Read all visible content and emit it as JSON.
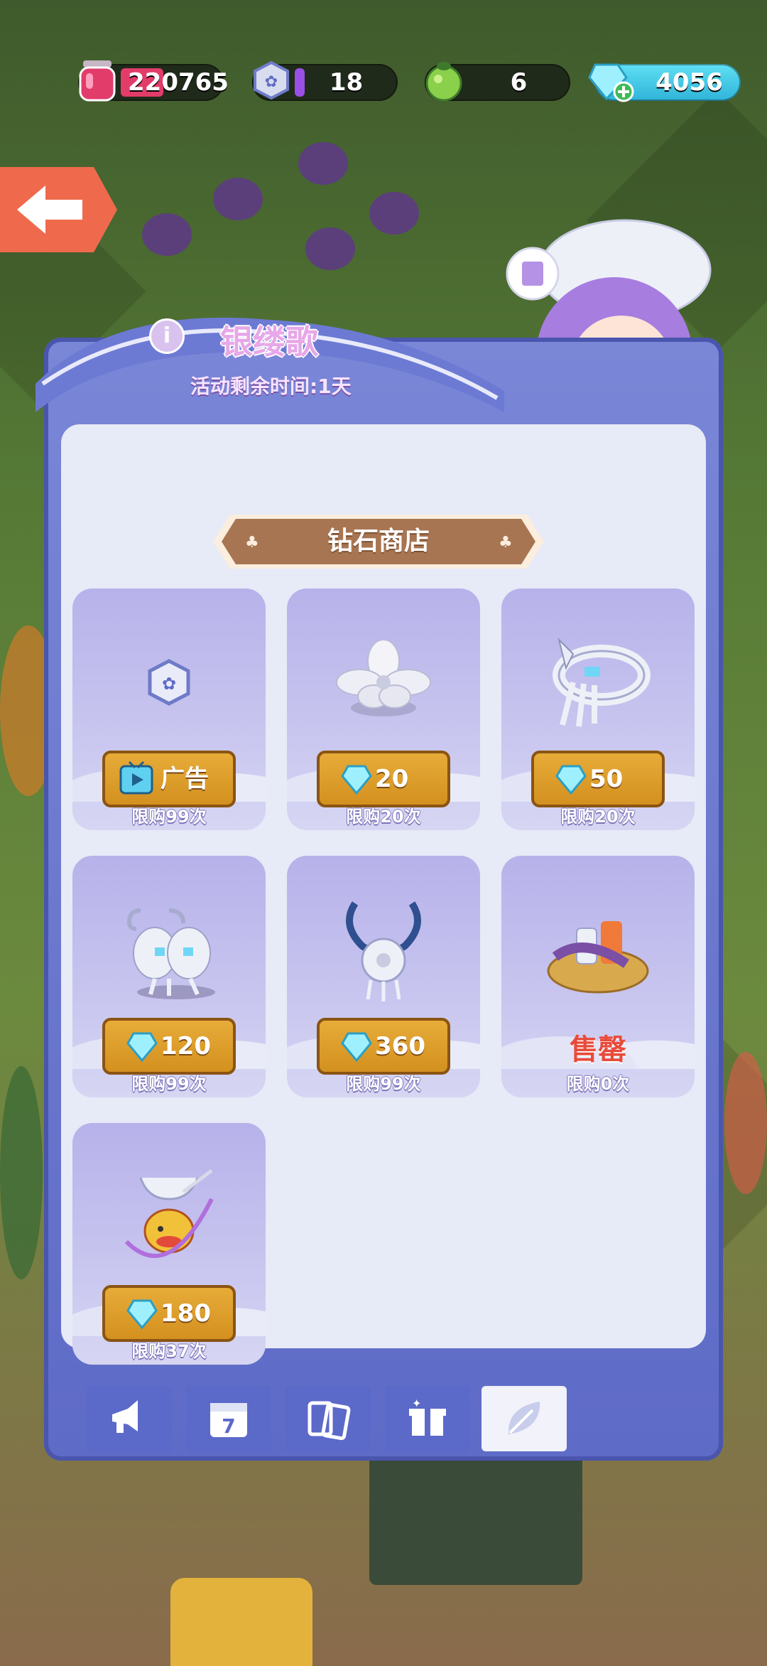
{
  "currencies": [
    {
      "name": "jam",
      "value": "220765",
      "icon": "jam-jar-icon",
      "color": "#e23c6a"
    },
    {
      "name": "badge",
      "value": "18",
      "icon": "silver-badge-icon",
      "color": "#9a4fe6"
    },
    {
      "name": "fruit",
      "value": "6",
      "icon": "green-fruit-icon",
      "color": "#8ad04a"
    },
    {
      "name": "diamond",
      "value": "4056",
      "icon": "diamond-plus-icon",
      "color": "#4fd7f0"
    }
  ],
  "event": {
    "title": "银缕歌",
    "remaining": "活动剩余时间:1天"
  },
  "shop": {
    "title": "钻石商店",
    "items": [
      {
        "name": "silver-badge",
        "button": "广告",
        "kind": "ad",
        "limit": "限购99次"
      },
      {
        "name": "silver-flower",
        "button": "20",
        "kind": "diamond",
        "limit": "限购20次"
      },
      {
        "name": "silver-bracelet",
        "button": "50",
        "kind": "diamond",
        "limit": "限购20次"
      },
      {
        "name": "butterfly-ornament",
        "button": "120",
        "kind": "diamond",
        "limit": "限购99次"
      },
      {
        "name": "silver-pendant",
        "button": "360",
        "kind": "diamond",
        "limit": "限购99次"
      },
      {
        "name": "yarn-basket",
        "button": "售罄",
        "kind": "soldout",
        "limit": "限购0次"
      },
      {
        "name": "silver-headdress-cat",
        "button": "180",
        "kind": "diamond",
        "limit": "限购37次"
      }
    ]
  },
  "tabs": [
    {
      "name": "tab-megaphone",
      "icon": "megaphone-icon",
      "active": false
    },
    {
      "name": "tab-calendar",
      "icon": "calendar-icon",
      "calendar_day": "7",
      "active": false
    },
    {
      "name": "tab-cards",
      "icon": "cards-icon",
      "active": false
    },
    {
      "name": "tab-gift",
      "icon": "gift-icon",
      "active": false
    },
    {
      "name": "tab-leaf",
      "icon": "leaf-icon",
      "active": true
    }
  ],
  "colors": {
    "accent": "#e8ad3a",
    "panel": "#5e6bc7",
    "soldout": "#e84b3b"
  }
}
